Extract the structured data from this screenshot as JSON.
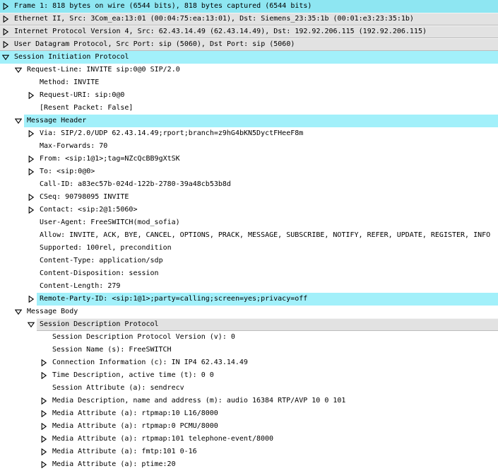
{
  "packet_tree": [
    {
      "level": 0,
      "expander": "collapsed",
      "style": "sel",
      "text": "Frame 1: 818 bytes on wire (6544 bits), 818 bytes captured (6544 bits)"
    },
    {
      "level": 0,
      "expander": "collapsed",
      "style": "gray",
      "text": "Ethernet II, Src: 3Com_ea:13:01 (00:04:75:ea:13:01), Dst: Siemens_23:35:1b (00:01:e3:23:35:1b)"
    },
    {
      "level": 0,
      "expander": "collapsed",
      "style": "gray",
      "text": "Internet Protocol Version 4, Src: 62.43.14.49 (62.43.14.49), Dst: 192.92.206.115 (192.92.206.115)"
    },
    {
      "level": 0,
      "expander": "collapsed",
      "style": "gray",
      "text": "User Datagram Protocol, Src Port: sip (5060), Dst Port: sip (5060)"
    },
    {
      "level": 0,
      "expander": "expanded",
      "style": "hl",
      "text": "Session Initiation Protocol"
    },
    {
      "level": 1,
      "expander": "expanded",
      "style": "",
      "text": "Request-Line: INVITE sip:0@0 SIP/2.0"
    },
    {
      "level": 2,
      "expander": "none",
      "style": "",
      "text": "Method: INVITE"
    },
    {
      "level": 2,
      "expander": "collapsed",
      "style": "",
      "text": "Request-URI: sip:0@0"
    },
    {
      "level": 2,
      "expander": "none",
      "style": "",
      "text": "[Resent Packet: False]"
    },
    {
      "level": 1,
      "expander": "expanded",
      "style": "hl",
      "text": "Message Header"
    },
    {
      "level": 2,
      "expander": "collapsed",
      "style": "",
      "text": "Via: SIP/2.0/UDP 62.43.14.49;rport;branch=z9hG4bKN5DyctFHeeF8m"
    },
    {
      "level": 2,
      "expander": "none",
      "style": "",
      "text": "Max-Forwards: 70"
    },
    {
      "level": 2,
      "expander": "collapsed",
      "style": "",
      "text": "From: <sip:1@1>;tag=NZcQcBB9gXtSK"
    },
    {
      "level": 2,
      "expander": "collapsed",
      "style": "",
      "text": "To: <sip:0@0>"
    },
    {
      "level": 2,
      "expander": "none",
      "style": "",
      "text": "Call-ID: a83ec57b-024d-122b-2780-39a48cb53b8d"
    },
    {
      "level": 2,
      "expander": "collapsed",
      "style": "",
      "text": "CSeq: 90798095 INVITE"
    },
    {
      "level": 2,
      "expander": "collapsed",
      "style": "",
      "text": "Contact: <sip:2@1:5060>"
    },
    {
      "level": 2,
      "expander": "none",
      "style": "",
      "text": "User-Agent: FreeSWITCH(mod_sofia)"
    },
    {
      "level": 2,
      "expander": "none",
      "style": "",
      "text": "Allow: INVITE, ACK, BYE, CANCEL, OPTIONS, PRACK, MESSAGE, SUBSCRIBE, NOTIFY, REFER, UPDATE, REGISTER, INFO"
    },
    {
      "level": 2,
      "expander": "none",
      "style": "",
      "text": "Supported: 100rel, precondition"
    },
    {
      "level": 2,
      "expander": "none",
      "style": "",
      "text": "Content-Type: application/sdp"
    },
    {
      "level": 2,
      "expander": "none",
      "style": "",
      "text": "Content-Disposition: session"
    },
    {
      "level": 2,
      "expander": "none",
      "style": "",
      "text": "Content-Length: 279"
    },
    {
      "level": 2,
      "expander": "collapsed",
      "style": "hl",
      "text": "Remote-Party-ID: <sip:1@1>;party=calling;screen=yes;privacy=off"
    },
    {
      "level": 1,
      "expander": "expanded",
      "style": "",
      "text": "Message Body"
    },
    {
      "level": 2,
      "expander": "expanded",
      "style": "gray",
      "text": "Session Description Protocol"
    },
    {
      "level": 3,
      "expander": "none",
      "style": "",
      "text": "Session Description Protocol Version (v): 0"
    },
    {
      "level": 3,
      "expander": "none",
      "style": "",
      "text": "Session Name (s): FreeSWITCH"
    },
    {
      "level": 3,
      "expander": "collapsed",
      "style": "",
      "text": "Connection Information (c): IN IP4 62.43.14.49"
    },
    {
      "level": 3,
      "expander": "collapsed",
      "style": "",
      "text": "Time Description, active time (t): 0 0"
    },
    {
      "level": 3,
      "expander": "none",
      "style": "",
      "text": "Session Attribute (a): sendrecv"
    },
    {
      "level": 3,
      "expander": "collapsed",
      "style": "",
      "text": "Media Description, name and address (m): audio 16384 RTP/AVP 10 0 101"
    },
    {
      "level": 3,
      "expander": "collapsed",
      "style": "",
      "text": "Media Attribute (a): rtpmap:10 L16/8000"
    },
    {
      "level": 3,
      "expander": "collapsed",
      "style": "",
      "text": "Media Attribute (a): rtpmap:0 PCMU/8000"
    },
    {
      "level": 3,
      "expander": "collapsed",
      "style": "",
      "text": "Media Attribute (a): rtpmap:101 telephone-event/8000"
    },
    {
      "level": 3,
      "expander": "collapsed",
      "style": "",
      "text": "Media Attribute (a): fmtp:101 0-16"
    },
    {
      "level": 3,
      "expander": "collapsed",
      "style": "",
      "text": "Media Attribute (a): ptime:20"
    }
  ]
}
